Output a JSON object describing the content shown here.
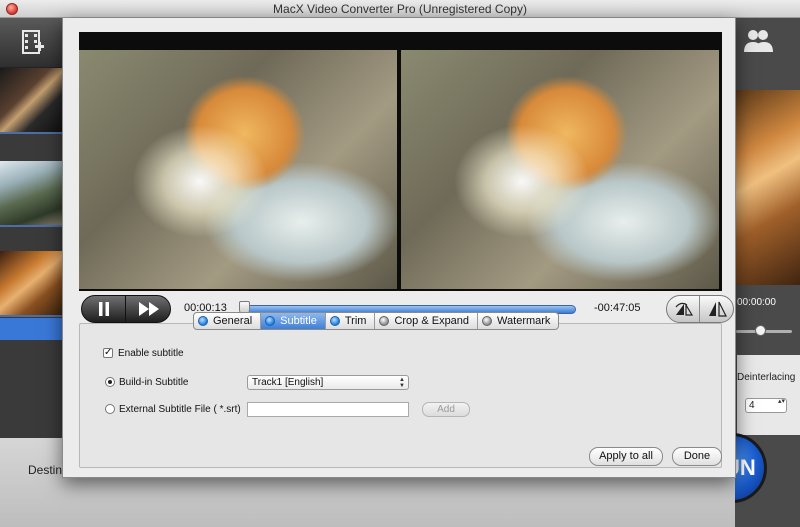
{
  "window": {
    "title": "MacX Video Converter Pro (Unregistered Copy)"
  },
  "main": {
    "destination_label": "Destination Folder:",
    "right_time": "00:00:00",
    "deinterlace_label": "Deinterlacing",
    "cpu_core_value": "4",
    "run_label": "RUN"
  },
  "player": {
    "current_time": "00:00:13",
    "remaining_time": "-00:47:05",
    "progress": 0.004
  },
  "tabs": [
    {
      "label": "General",
      "icon": "blue"
    },
    {
      "label": "Subtitle",
      "icon": "blue",
      "active": true
    },
    {
      "label": "Trim",
      "icon": "blue"
    },
    {
      "label": "Crop & Expand",
      "icon": "grey"
    },
    {
      "label": "Watermark",
      "icon": "grey"
    }
  ],
  "subtitle": {
    "enable_label": "Enable subtitle",
    "enable_checked": true,
    "builtin_label": "Build-in Subtitle",
    "builtin_selected": true,
    "track_value": "Track1 [English]",
    "external_label": "External Subtitle File ( *.srt)",
    "external_value": "",
    "add_label": "Add"
  },
  "buttons": {
    "apply_all": "Apply to all",
    "done": "Done"
  }
}
